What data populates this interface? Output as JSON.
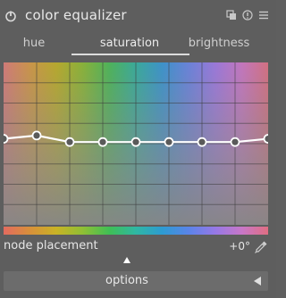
{
  "header": {
    "title": "color equalizer",
    "icons": [
      "power-icon",
      "multi-instance-icon",
      "reset-icon",
      "presets-icon"
    ]
  },
  "tabs": [
    {
      "label": "hue"
    },
    {
      "label": "saturation",
      "active": true
    },
    {
      "label": "brightness"
    }
  ],
  "graph": {
    "curve_levels": [
      0.47,
      0.45,
      0.49,
      0.49,
      0.49,
      0.49,
      0.49,
      0.49,
      0.47
    ],
    "accent_color": "#ffffff"
  },
  "node_placement": {
    "label": "node placement",
    "value": "+0°",
    "picker_icon": "color-picker-icon"
  },
  "options": {
    "label": "options",
    "arrow_icon": "triangle-left-icon"
  }
}
